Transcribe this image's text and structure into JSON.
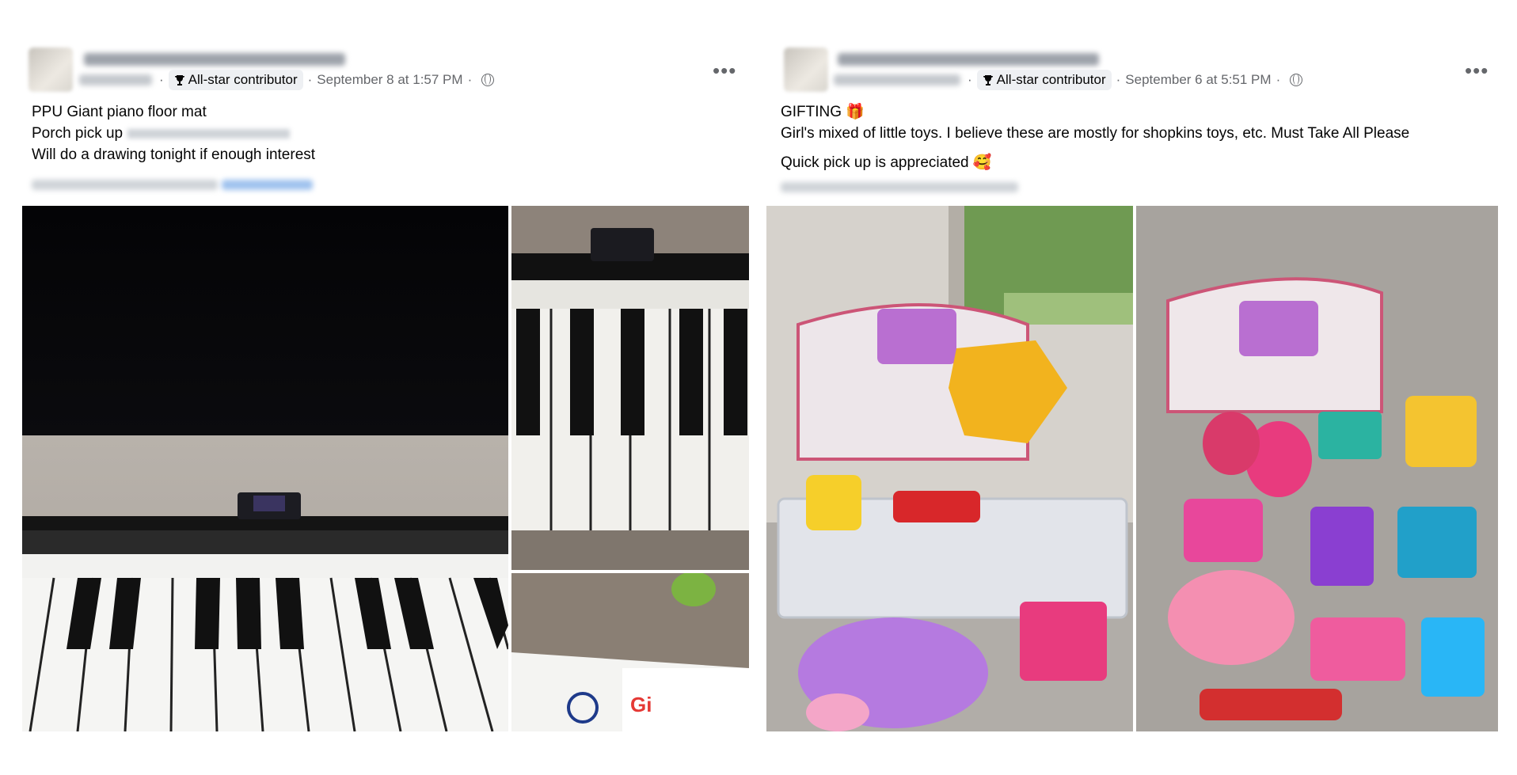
{
  "posts": [
    {
      "badge": "All-star contributor",
      "timestamp": "September 8 at 1:57 PM",
      "separator": "·",
      "more": "•••",
      "lines": [
        "PPU Giant piano floor mat",
        "Porch pick up",
        "Will do a drawing tonight if enough interest"
      ]
    },
    {
      "badge": "All-star contributor",
      "timestamp": "September 6 at 5:51 PM",
      "separator": "·",
      "more": "•••",
      "lines": [
        "GIFTING 🎁",
        "Girl's mixed of little toys. I believe these are mostly for shopkins toys, etc. Must Take All Please",
        "Quick pick up is appreciated 🥰"
      ]
    }
  ],
  "icons": {
    "badge": "trophy-icon",
    "privacy": "globe-icon",
    "menu": "more-icon"
  },
  "colors": {
    "meta": "#65676b",
    "badge_bg": "#eef0f3",
    "text": "#050505"
  }
}
